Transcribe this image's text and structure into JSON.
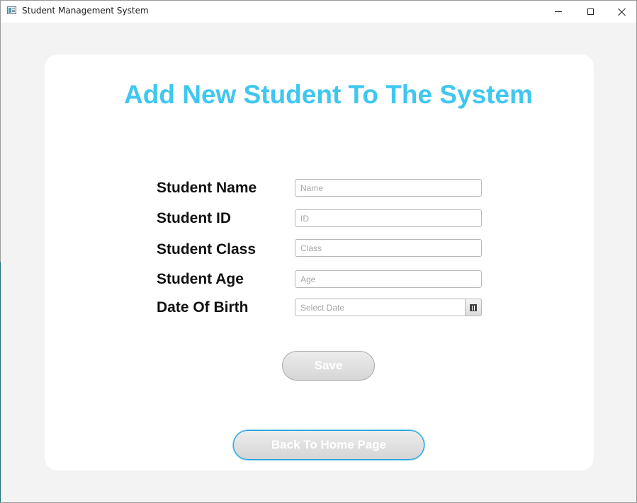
{
  "window": {
    "title": "Student Management System"
  },
  "form": {
    "heading": "Add New Student To The System",
    "fields": [
      {
        "label": "Student Name",
        "placeholder": "Name",
        "value": ""
      },
      {
        "label": "Student ID",
        "placeholder": "ID",
        "value": ""
      },
      {
        "label": "Student Class",
        "placeholder": "Class",
        "value": ""
      },
      {
        "label": "Student Age",
        "placeholder": "Age",
        "value": ""
      }
    ],
    "date_of_birth": {
      "label": "Date Of Birth",
      "placeholder": "Select Date",
      "icon": "calendar-icon"
    },
    "save_label": "Save",
    "back_label": "Back To Home Page"
  },
  "colors": {
    "heading": "#3fc7f0",
    "card_background": "#ffffff",
    "window_background": "#f3f3f3",
    "focus_border": "#1ea0e0"
  }
}
